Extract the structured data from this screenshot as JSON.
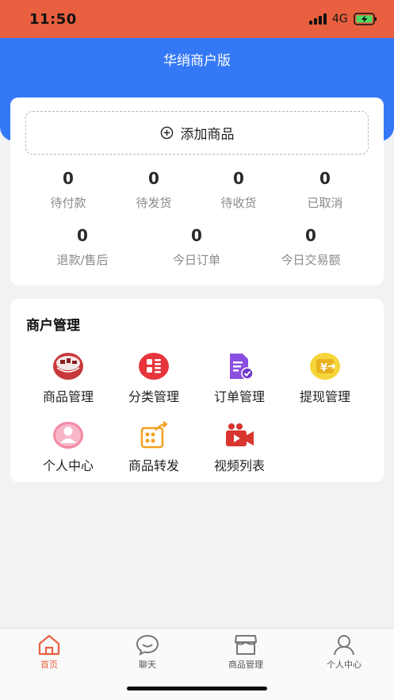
{
  "status_bar": {
    "time": "11:50",
    "network": "4G",
    "background": "#e8603f"
  },
  "header": {
    "title": "华绡商户版",
    "background": "#3478f6"
  },
  "summary": {
    "add_button_label": "添加商品",
    "row1": [
      {
        "value": "0",
        "label": "待付款"
      },
      {
        "value": "0",
        "label": "待发货"
      },
      {
        "value": "0",
        "label": "待收货"
      },
      {
        "value": "0",
        "label": "已取消"
      }
    ],
    "row2": [
      {
        "value": "0",
        "label": "退款/售后"
      },
      {
        "value": "0",
        "label": "今日订单"
      },
      {
        "value": "0",
        "label": "今日交易额"
      }
    ]
  },
  "management": {
    "title": "商户管理",
    "items": [
      {
        "label": "商品管理",
        "icon": "product-bowl-icon"
      },
      {
        "label": "分类管理",
        "icon": "category-grid-icon"
      },
      {
        "label": "订单管理",
        "icon": "order-document-icon"
      },
      {
        "label": "提现管理",
        "icon": "yen-withdraw-icon"
      },
      {
        "label": "个人中心",
        "icon": "person-avatar-icon"
      },
      {
        "label": "商品转发",
        "icon": "forward-share-icon"
      },
      {
        "label": "视频列表",
        "icon": "video-camera-icon"
      }
    ]
  },
  "tab_bar": {
    "active_color": "#e8603f",
    "tabs": [
      {
        "label": "首页",
        "icon": "home-icon",
        "active": true
      },
      {
        "label": "聊天",
        "icon": "chat-icon",
        "active": false
      },
      {
        "label": "商品管理",
        "icon": "store-icon",
        "active": false
      },
      {
        "label": "个人中心",
        "icon": "user-icon",
        "active": false
      }
    ]
  }
}
